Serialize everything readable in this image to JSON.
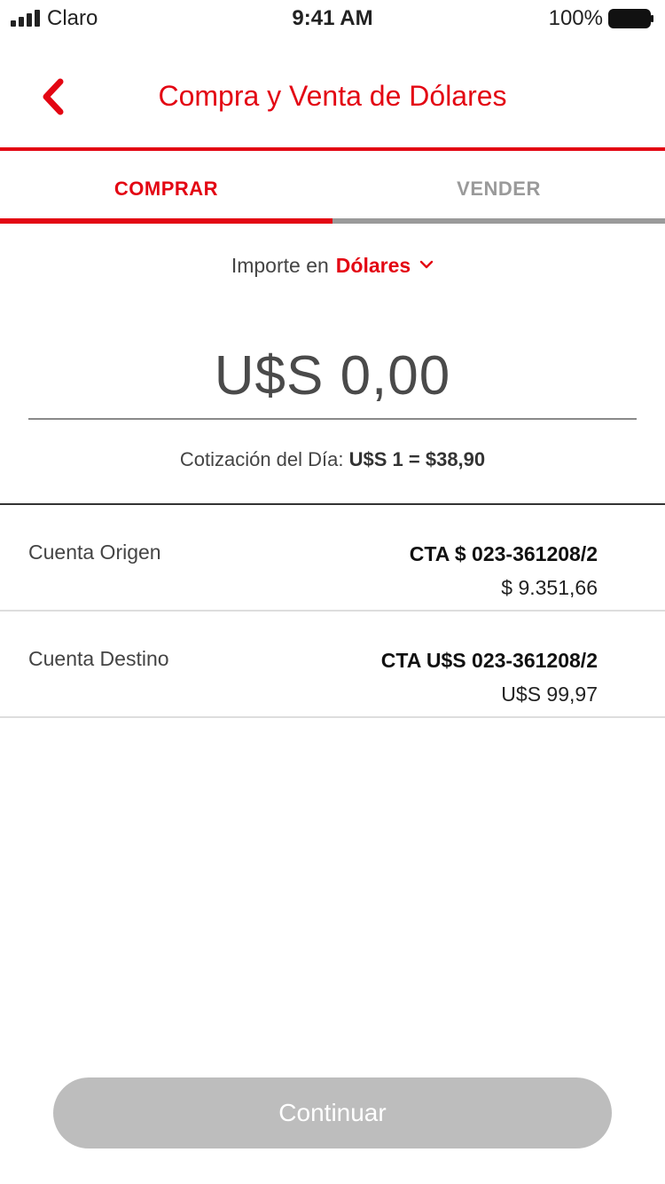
{
  "status_bar": {
    "carrier": "Claro",
    "time": "9:41 AM",
    "battery": "100%"
  },
  "header": {
    "title": "Compra y Venta de Dólares",
    "back_icon": "chevron-left-icon"
  },
  "tabs": [
    {
      "label": "COMPRAR",
      "active": true
    },
    {
      "label": "VENDER",
      "active": false
    }
  ],
  "currency": {
    "label": "Importe en",
    "value": "Dólares",
    "icon": "chevron-down-icon"
  },
  "amount": {
    "value": "U$S 0,00"
  },
  "rate": {
    "label": "Cotización del Día:",
    "value": "U$S 1 = $38,90"
  },
  "accounts": {
    "origin": {
      "label": "Cuenta Origen",
      "number": "CTA $ 023-361208/2",
      "balance": "$ 9.351,66"
    },
    "destination": {
      "label": "Cuenta Destino",
      "number": "CTA U$S 023-361208/2",
      "balance": "U$S 99,97"
    }
  },
  "actions": {
    "continue_label": "Continuar"
  },
  "colors": {
    "brand": "#e30613",
    "inactive": "#9a9a9a",
    "button_disabled": "#bdbdbd"
  }
}
